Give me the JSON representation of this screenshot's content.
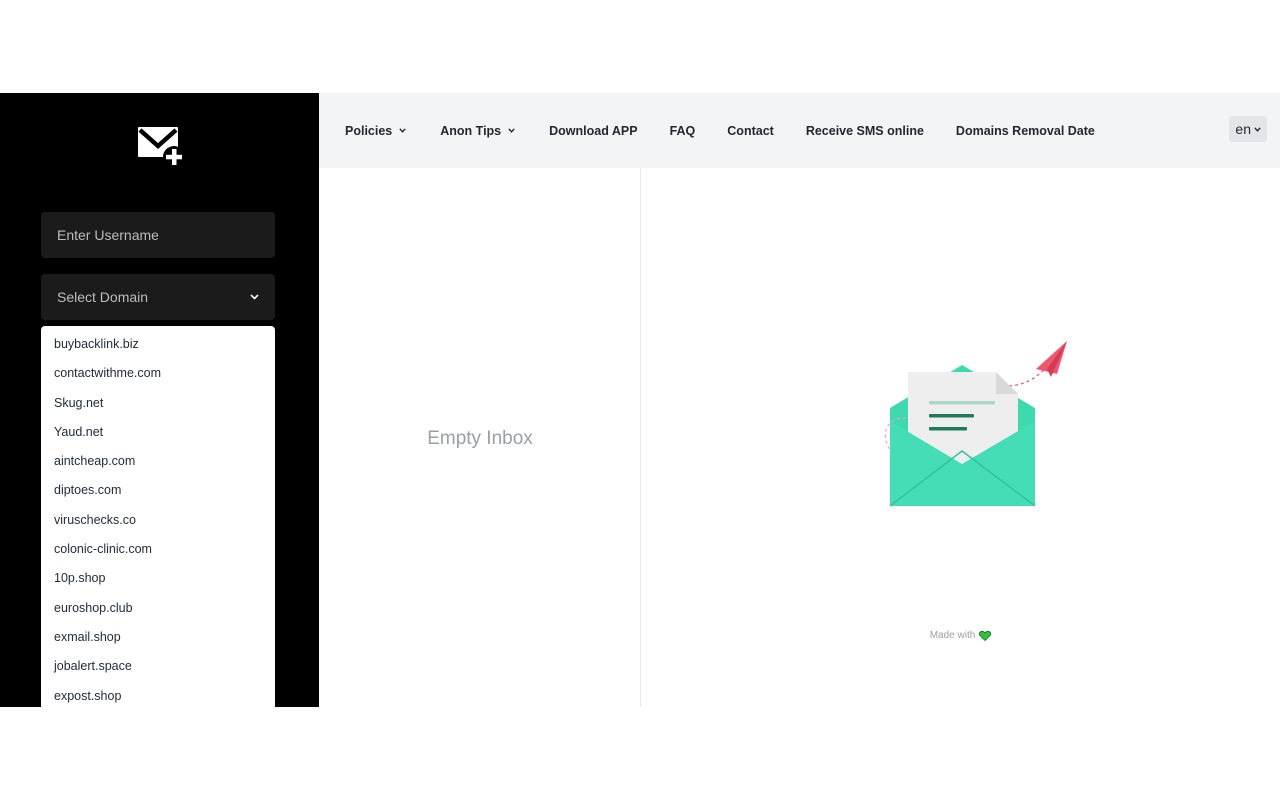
{
  "sidebar": {
    "logo_icon": "mail-plus-icon",
    "username_placeholder": "Enter Username",
    "domain_select_label": "Select Domain",
    "domains": [
      "buybacklink.biz",
      "contactwithme.com",
      "Skug.net",
      "Yaud.net",
      "aintcheap.com",
      "diptoes.com",
      "viruschecks.co",
      "colonic-clinic.com",
      "10p.shop",
      "euroshop.club",
      "exmail.shop",
      "jobalert.space",
      "expost.shop"
    ]
  },
  "nav": {
    "items": [
      {
        "label": "Policies",
        "dropdown": true
      },
      {
        "label": "Anon Tips",
        "dropdown": true
      },
      {
        "label": "Download APP",
        "dropdown": false
      },
      {
        "label": "FAQ",
        "dropdown": false
      },
      {
        "label": "Contact",
        "dropdown": false
      },
      {
        "label": "Receive SMS online",
        "dropdown": false
      },
      {
        "label": "Domains Removal Date",
        "dropdown": false
      }
    ],
    "language": "en"
  },
  "main": {
    "empty_inbox_text": "Empty Inbox",
    "illustration_icon": "open-envelope-paper-plane-illustration",
    "footer_made_with": "Made with",
    "footer_heart_icon": "heart-icon"
  },
  "colors": {
    "sidebar_bg": "#000000",
    "envelope": "#3fd9b0",
    "heart": "#2fc43a",
    "plane": "#f2566e"
  }
}
